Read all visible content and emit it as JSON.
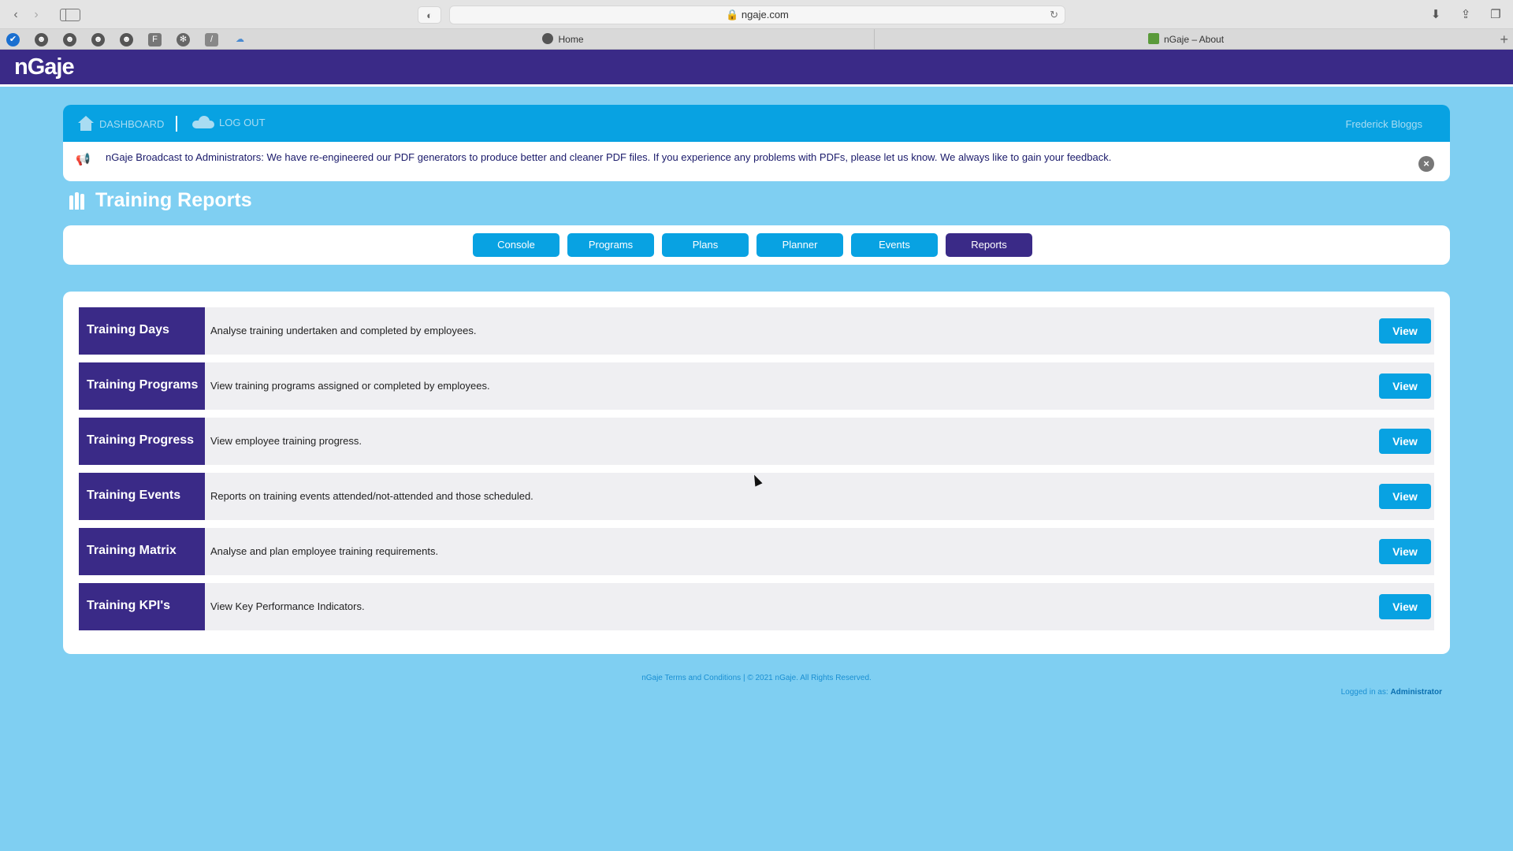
{
  "browser": {
    "url": "ngaje.com",
    "tabs": [
      {
        "label": "Home"
      },
      {
        "label": "nGaje – About"
      }
    ]
  },
  "app": {
    "logo": "nGaje"
  },
  "topnav": {
    "dashboard": "DASHBOARD",
    "logout": "LOG OUT",
    "username": "Frederick Bloggs"
  },
  "broadcast": {
    "text": "nGaje Broadcast to Administrators: We have re-engineered our PDF generators to produce better and cleaner PDF files. If you experience any problems with PDFs, please let us know. We always like to gain your feedback."
  },
  "page": {
    "title": "Training Reports"
  },
  "subnav": [
    {
      "label": "Console"
    },
    {
      "label": "Programs"
    },
    {
      "label": "Plans"
    },
    {
      "label": "Planner"
    },
    {
      "label": "Events"
    },
    {
      "label": "Reports",
      "active": true
    }
  ],
  "reports": [
    {
      "title": "Training Days",
      "description": "Analyse training undertaken and completed by employees.",
      "action": "View"
    },
    {
      "title": "Training Programs",
      "description": "View training programs assigned or completed by employees.",
      "action": "View"
    },
    {
      "title": "Training Progress",
      "description": "View employee training progress.",
      "action": "View"
    },
    {
      "title": "Training Events",
      "description": "Reports on training events attended/not-attended and those scheduled.",
      "action": "View"
    },
    {
      "title": "Training Matrix",
      "description": "Analyse and plan employee training requirements.",
      "action": "View"
    },
    {
      "title": "Training KPI's",
      "description": "View Key Performance Indicators.",
      "action": "View"
    }
  ],
  "footer": {
    "center": "nGaje Terms and Conditions  |  © 2021 nGaje. All Rights Reserved.",
    "logged_in_prefix": "Logged in as:",
    "logged_in_role": "Administrator"
  },
  "colors": {
    "page_bg": "#7fcff2",
    "brand_purple": "#3a2a87",
    "accent_blue": "#08a2e2"
  }
}
